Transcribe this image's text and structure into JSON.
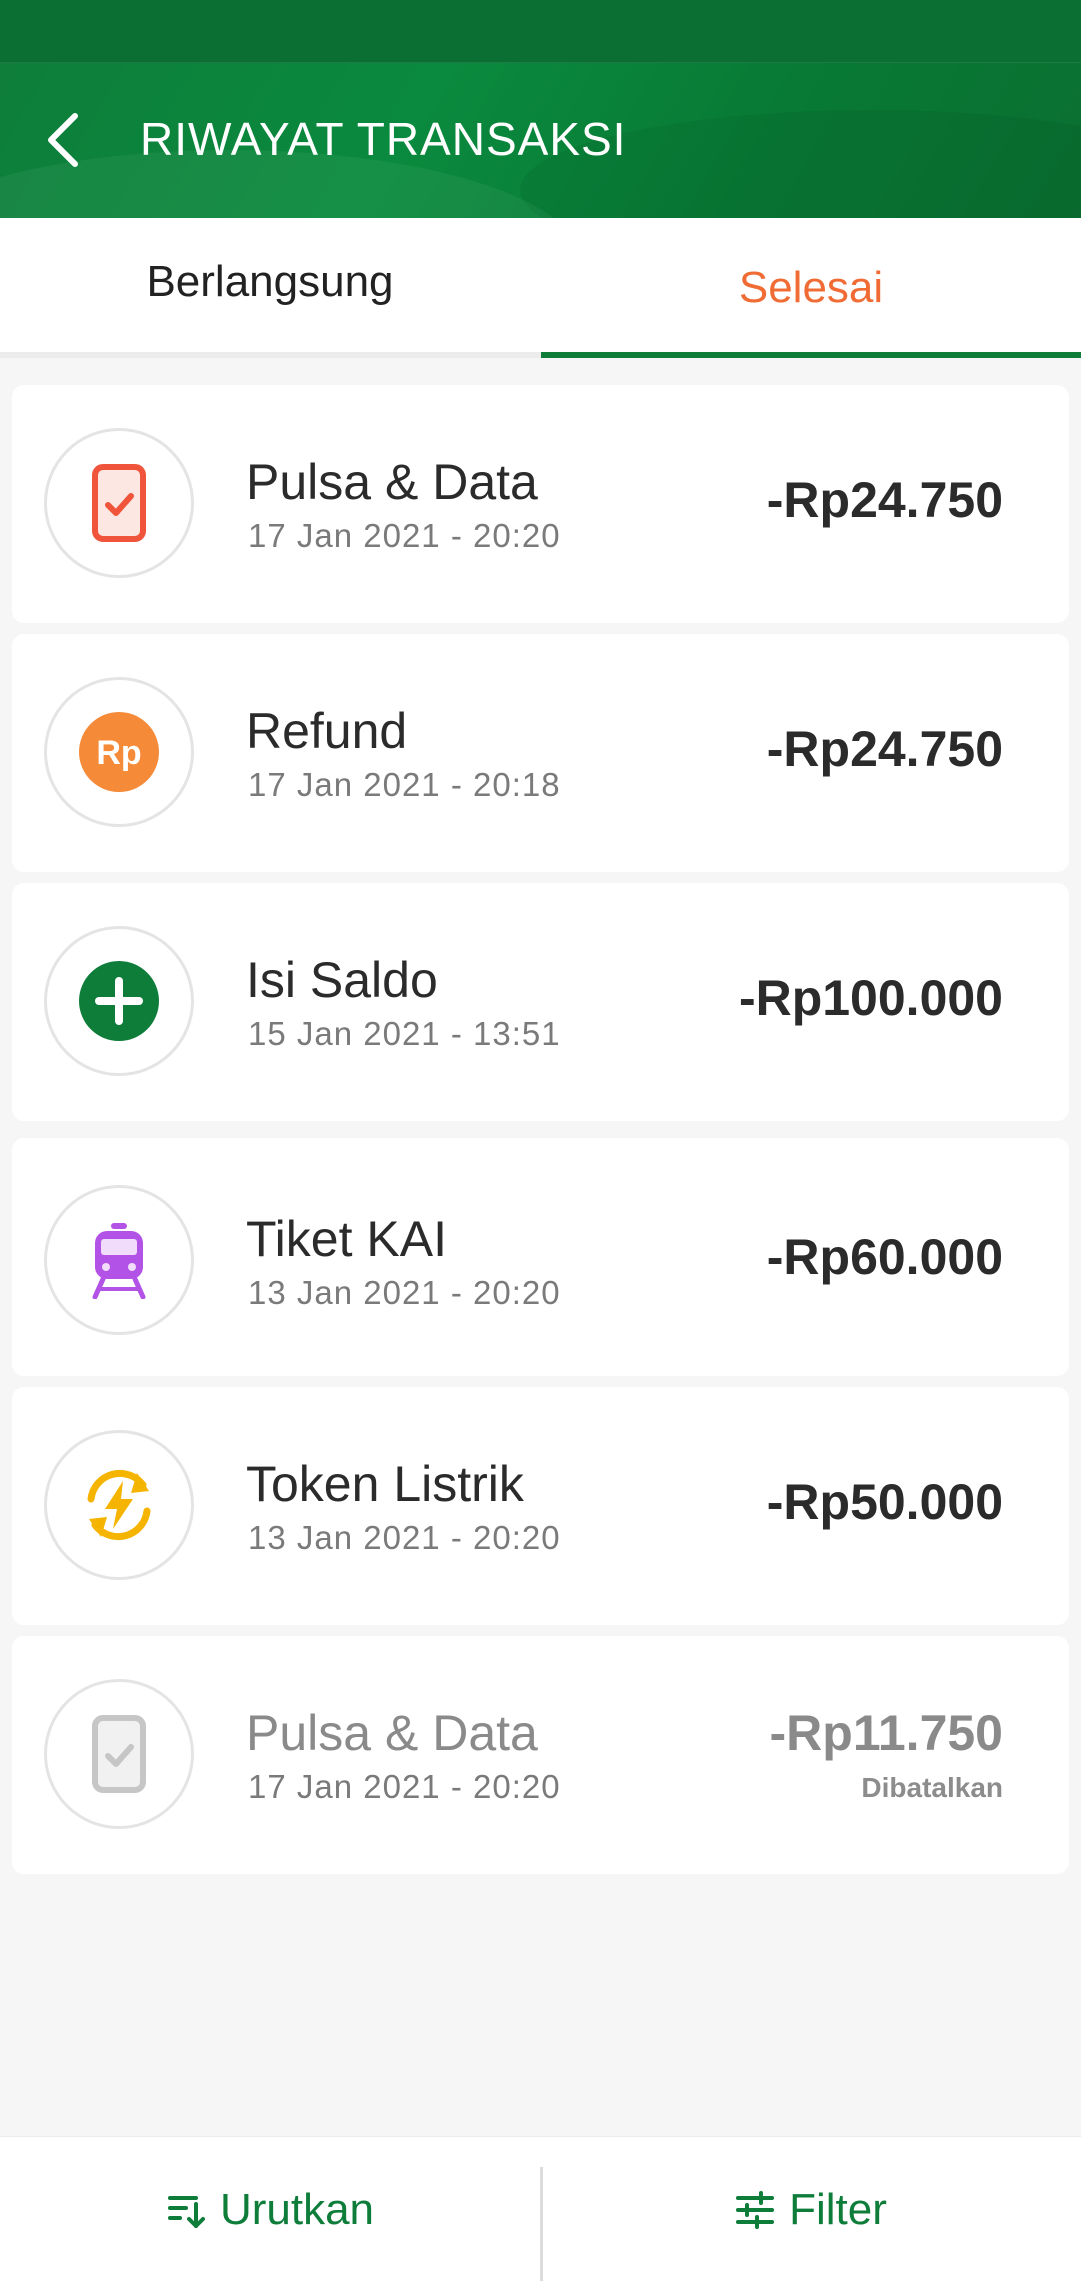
{
  "header": {
    "title": "RIWAYAT TRANSAKSI",
    "back_icon": "chevron-left-icon",
    "background": "#0e7d3a"
  },
  "tabs": [
    {
      "label": "Berlangsung",
      "active": false
    },
    {
      "label": "Selesai",
      "active": true
    }
  ],
  "colors": {
    "accent_green": "#0e7d3a",
    "active_tab": "#f06c34",
    "text_dark": "#2b2b2b",
    "text_muted": "#7a7a7a"
  },
  "transactions": [
    {
      "title": "Pulsa & Data",
      "date": "17 Jan 2021 - 20:20",
      "amount": "-Rp24.750",
      "status": "",
      "icon": "phone-check-icon"
    },
    {
      "title": "Refund",
      "date": "17 Jan 2021 - 20:18",
      "amount": "-Rp24.750",
      "status": "",
      "icon": "rupiah-coin-icon",
      "icon_text": "Rp"
    },
    {
      "title": "Isi Saldo",
      "date": "15 Jan 2021 - 13:51",
      "amount": "-Rp100.000",
      "status": "",
      "icon": "plus-circle-icon"
    },
    {
      "title": "Tiket KAI",
      "date": "13 Jan 2021 - 20:20",
      "amount": "-Rp60.000",
      "status": "",
      "icon": "train-icon"
    },
    {
      "title": "Token Listrik",
      "date": "13 Jan 2021 - 20:20",
      "amount": "-Rp50.000",
      "status": "",
      "icon": "electricity-token-icon"
    },
    {
      "title": "Pulsa & Data",
      "date": "17 Jan 2021 - 20:20",
      "amount": "-Rp11.750",
      "status": "Dibatalkan",
      "icon": "phone-check-icon"
    }
  ],
  "bottom_bar": {
    "sort_label": "Urutkan",
    "sort_icon": "sort-icon",
    "filter_label": "Filter",
    "filter_icon": "sliders-icon"
  }
}
